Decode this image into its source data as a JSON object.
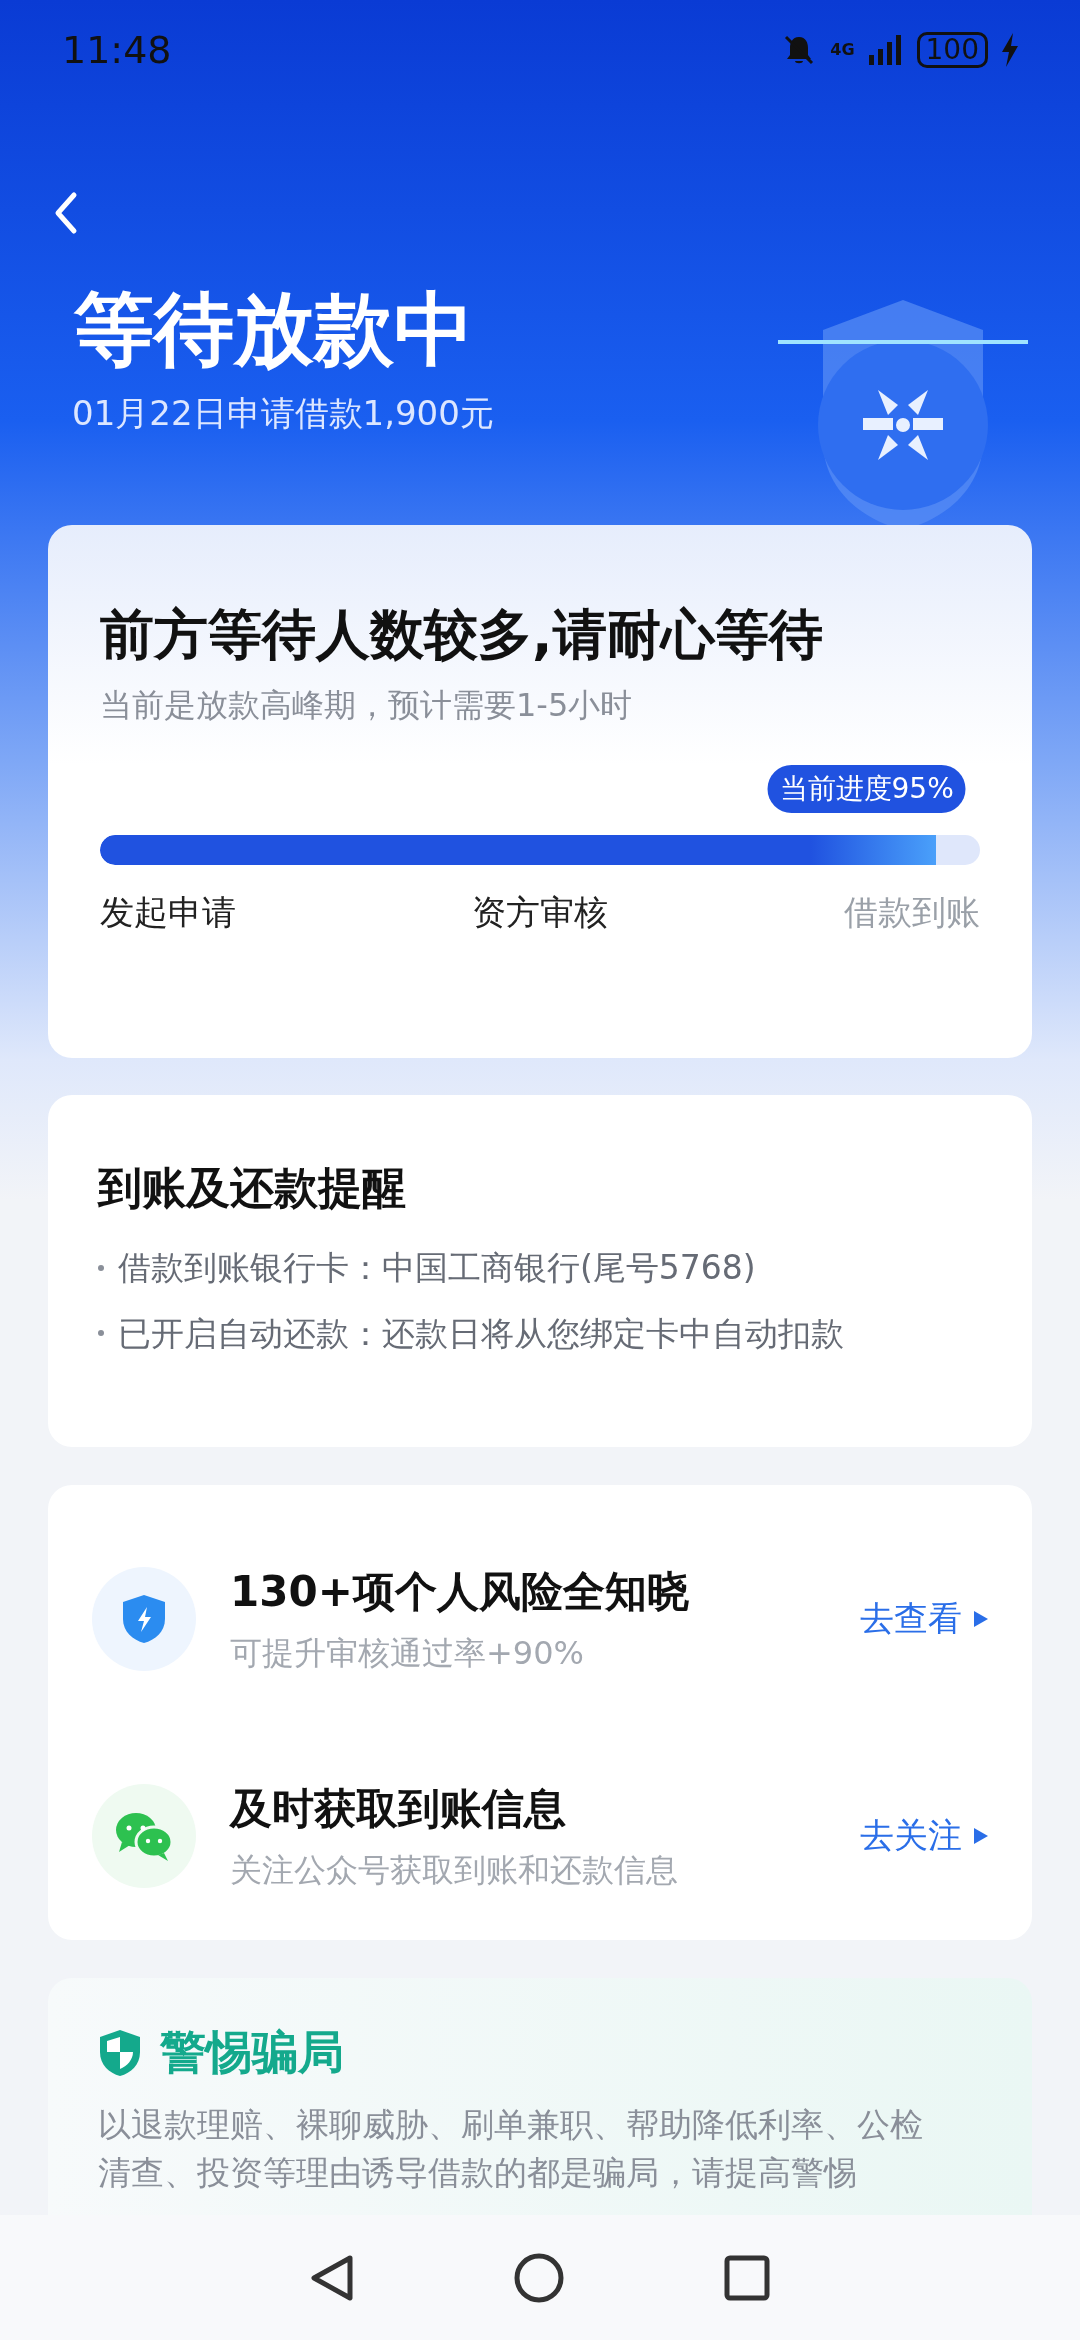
{
  "status_bar": {
    "time": "11:48",
    "network": "4G",
    "battery": "100"
  },
  "header": {
    "title": "等待放款中",
    "subtitle": "01月22日申请借款1,900元"
  },
  "progress_card": {
    "title": "前方等待人数较多,请耐心等待",
    "subtitle": "当前是放款高峰期，预计需要1-5小时",
    "badge": "当前进度95%",
    "level": 0.95,
    "steps": [
      {
        "label": "发起申请",
        "reached": true
      },
      {
        "label": "资方审核",
        "reached": true
      },
      {
        "label": "借款到账",
        "reached": false
      }
    ]
  },
  "reminder_card": {
    "title": "到账及还款提醒",
    "items": [
      "借款到账银行卡：中国工商银行(尾号5768)",
      "已开启自动还款：还款日将从您绑定卡中自动扣款"
    ]
  },
  "service_card": {
    "items": [
      {
        "kind": "shield",
        "title": "130+项个人风险全知晓",
        "subtitle": "可提升审核通过率+90%",
        "action": "去查看"
      },
      {
        "kind": "chat",
        "title": "及时获取到账信息",
        "subtitle": "关注公众号获取到账和还款信息",
        "action": "去关注"
      }
    ]
  },
  "warning_card": {
    "title": "警惕骗局",
    "text": "以退款理赔、裸聊威胁、刷单兼职、帮助降低利率、公检清查、投资等理由诱导借款的都是骗局，请提高警惕"
  }
}
